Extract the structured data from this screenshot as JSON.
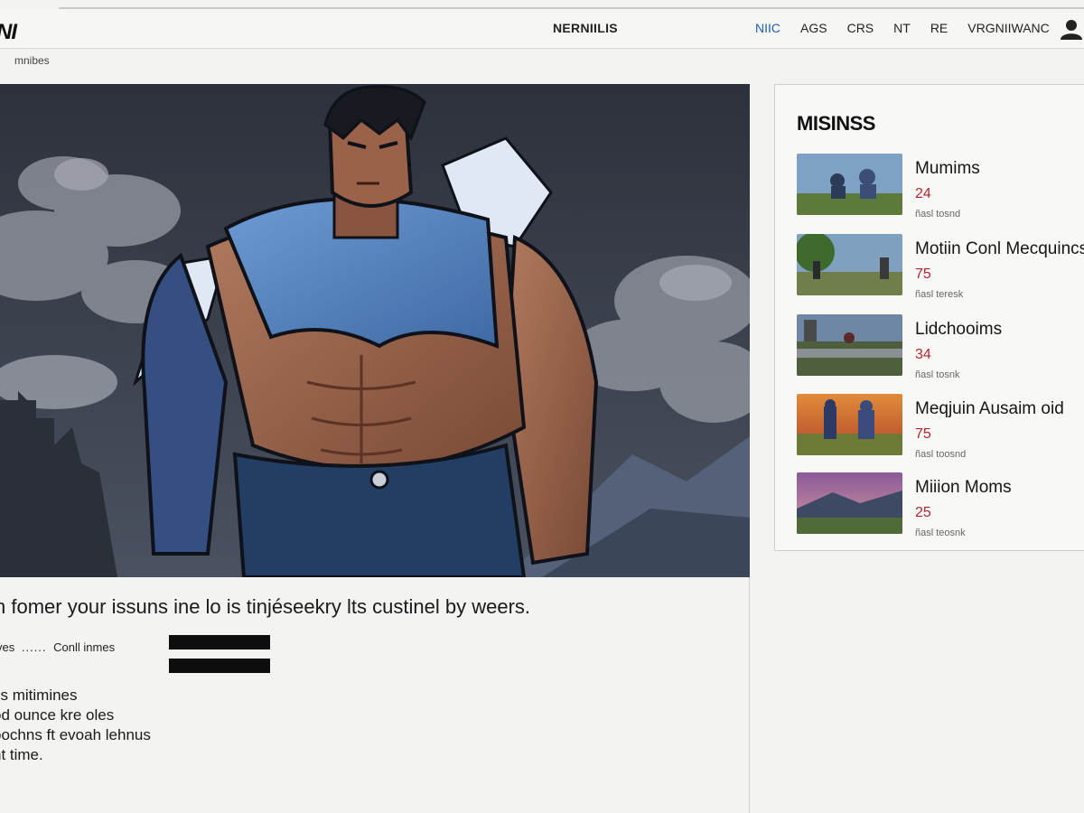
{
  "header": {
    "logo": "NI",
    "site_title": "NERNIILIS",
    "nav": [
      "NIIC",
      "AGS",
      "CRS",
      "NT",
      "RE",
      "VRGNIIWANC"
    ],
    "active_nav": "NIIC",
    "breadcrumb": "mnibes"
  },
  "article": {
    "caption": "n fomer your issuns ine lo is tinjéseekry lts custinel by weers.",
    "meta_left": "ves",
    "meta_dots": "......",
    "meta_right": "Conll inmes",
    "body_lines": [
      "ss mitimines",
      "od ounce kre oles",
      "oochns ft evoah lehnus",
      "nt time."
    ]
  },
  "sidebar": {
    "title": "MISINSS",
    "items": [
      {
        "title": "Mumims",
        "count": "24",
        "sub": "ñasl tosnd"
      },
      {
        "title": "Motiin Conl Mecquincs",
        "count": "75",
        "sub": "ñasl teresk"
      },
      {
        "title": "Lidchooims",
        "count": "34",
        "sub": "ñasl tosnk"
      },
      {
        "title": "Meqjuin Ausaim oid",
        "count": "75",
        "sub": "ñasl toosnd"
      },
      {
        "title": "Miiion Moms",
        "count": "25",
        "sub": "ñasl teosnk"
      }
    ]
  },
  "colors": {
    "accent": "#1f5fb8",
    "count": "#b4262b",
    "hero_sky": "#3a3f4b"
  },
  "icons": {
    "user": "user-icon",
    "menu": "hamburger-icon"
  }
}
